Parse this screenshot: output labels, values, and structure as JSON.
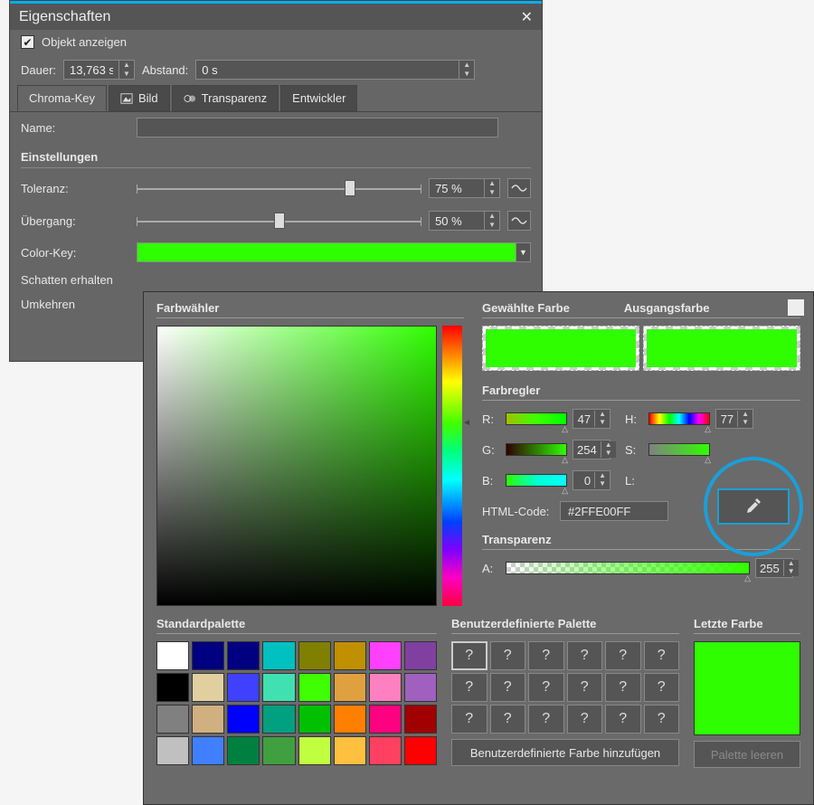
{
  "props": {
    "title": "Eigenschaften",
    "show_object": "Objekt anzeigen",
    "duration_label": "Dauer:",
    "duration_value": "13,763 s",
    "distance_label": "Abstand:",
    "distance_value": "0 s",
    "tabs": {
      "chroma": "Chroma-Key",
      "image": "Bild",
      "trans": "Transparenz",
      "dev": "Entwickler"
    },
    "name_label": "Name:",
    "settings": "Einstellungen",
    "tolerance_label": "Toleranz:",
    "tolerance_value": "75 %",
    "transition_label": "Übergang:",
    "transition_value": "50 %",
    "colorkey_label": "Color-Key:",
    "shadow_label": "Schatten erhalten",
    "invert_label": "Umkehren"
  },
  "cp": {
    "picker": "Farbwähler",
    "selected": "Gewählte Farbe",
    "original": "Ausgangsfarbe",
    "regler": "Farbregler",
    "r": "R:",
    "g": "G:",
    "b": "B:",
    "h": "H:",
    "s": "S:",
    "l": "L:",
    "rv": "47",
    "gv": "254",
    "bv": "0",
    "hv": "77",
    "html_label": "HTML-Code:",
    "html_value": "#2FFE00FF",
    "trans": "Transparenz",
    "a": "A:",
    "av": "255",
    "stdpal": "Standardpalette",
    "usrpal": "Benutzerdefinierte Palette",
    "lastc": "Letzte Farbe",
    "addbtn": "Benutzerdefinierte Farbe hinzufügen",
    "clearbtn": "Palette leeren",
    "q": "?"
  },
  "palette": [
    "#ffffff",
    "#000080",
    "#000080",
    "#00c0c0",
    "#808000",
    "#c09000",
    "#ff40ff",
    "#8040a0",
    "#000000",
    "#e0d0a0",
    "#4040ff",
    "#40e0b0",
    "#40ff00",
    "#e0a040",
    "#ff80c0",
    "#a060c0",
    "#808080",
    "#d0b080",
    "#0000ff",
    "#00a080",
    "#00c000",
    "#ff8000",
    "#ff0080",
    "#a00000",
    "#c0c0c0",
    "#4080ff",
    "#008040",
    "#40a040",
    "#c0ff40",
    "#ffc040",
    "#ff4060",
    "#ff0000"
  ]
}
